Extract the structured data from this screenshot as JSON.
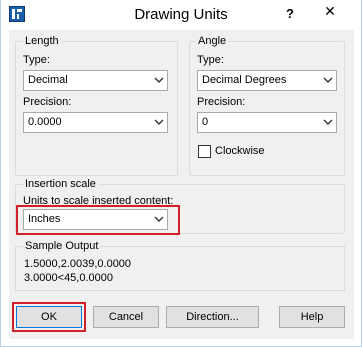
{
  "window": {
    "title": "Drawing Units",
    "help_label": "?",
    "close_label": "✕"
  },
  "length": {
    "group_label": "Length",
    "type_label": "Type:",
    "type_value": "Decimal",
    "precision_label": "Precision:",
    "precision_value": "0.0000"
  },
  "angle": {
    "group_label": "Angle",
    "type_label": "Type:",
    "type_value": "Decimal Degrees",
    "precision_label": "Precision:",
    "precision_value": "0",
    "clockwise_label": "Clockwise",
    "clockwise_checked": false
  },
  "insertion": {
    "group_label": "Insertion scale",
    "units_label": "Units to scale inserted content:",
    "units_value": "Inches"
  },
  "sample": {
    "group_label": "Sample Output",
    "line1": "1.5000,2.0039,0.0000",
    "line2": "3.0000<45,0.0000"
  },
  "buttons": {
    "ok": "OK",
    "cancel": "Cancel",
    "direction": "Direction...",
    "help": "Help"
  },
  "colors": {
    "highlight": "#d0202a",
    "dialog_bg": "#f0f0f0"
  }
}
